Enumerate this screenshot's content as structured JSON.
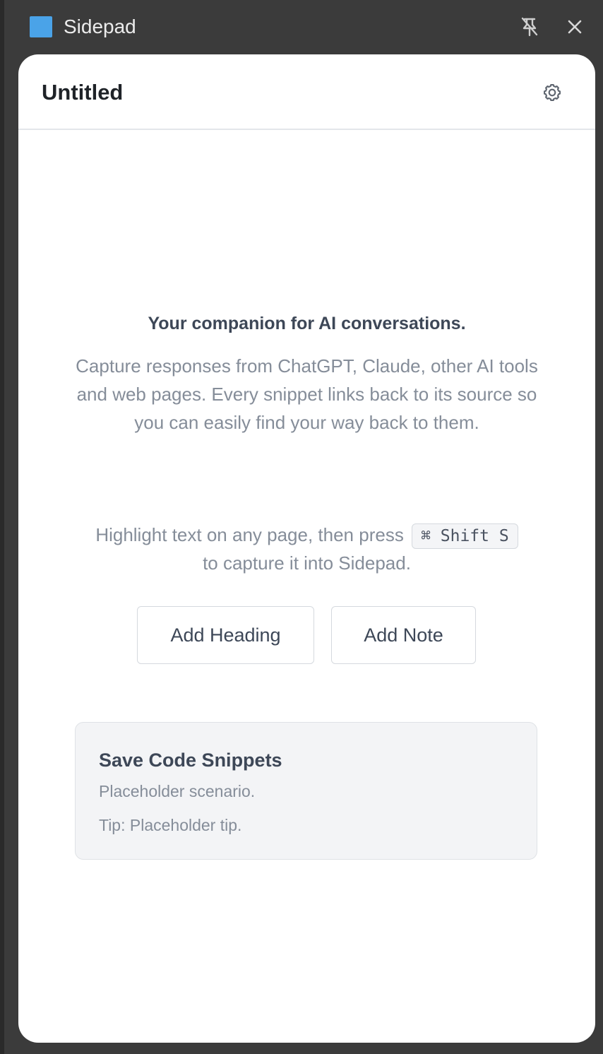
{
  "titlebar": {
    "app_title": "Sidepad",
    "app_icon": "sidepad-square-icon",
    "unpin_icon": "pin-off-icon",
    "close_icon": "close-icon"
  },
  "panel": {
    "doc_title": "Untitled",
    "settings_icon": "gear-icon"
  },
  "empty_state": {
    "tagline": "Your companion for AI conversations.",
    "description": "Capture responses from ChatGPT, Claude, other AI tools and web pages. Every snippet links back to its source so you can easily find your way back to them.",
    "hint_before": "Highlight text on any page, then press",
    "shortcut": "⌘ Shift S",
    "hint_after": "to capture it into Sidepad."
  },
  "actions": {
    "add_heading": "Add Heading",
    "add_note": "Add Note"
  },
  "card": {
    "title": "Save Code Snippets",
    "text": "Placeholder scenario.",
    "tip": "Tip: Placeholder tip."
  },
  "colors": {
    "accent": "#4aa3e8",
    "titlebar_bg": "#3b3b3b",
    "panel_bg": "#ffffff",
    "card_bg": "#f3f4f6"
  }
}
